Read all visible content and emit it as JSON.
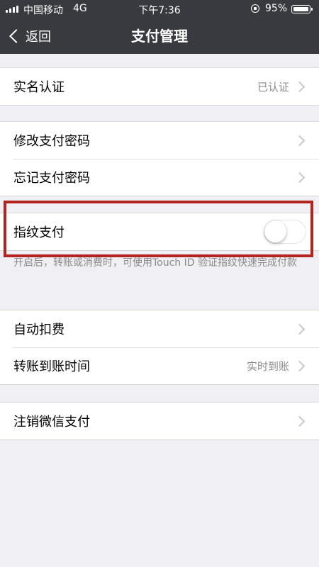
{
  "status_bar": {
    "carrier": "中国移动",
    "network": "4G",
    "time": "下午7:36",
    "battery_percent": "95%"
  },
  "nav": {
    "back_label": "返回",
    "title": "支付管理"
  },
  "groups": {
    "real_name": {
      "label": "实名认证",
      "value": "已认证"
    },
    "password": {
      "change_label": "修改支付密码",
      "forgot_label": "忘记支付密码"
    },
    "fingerprint": {
      "label": "指纹支付",
      "toggle_on": false,
      "hint": "开启后，转账或消费时，可使用Touch ID 验证指纹快速完成付款"
    },
    "payments": {
      "auto_deduct_label": "自动扣费",
      "transfer_time_label": "转账到账时间",
      "transfer_time_value": "实时到账"
    },
    "cancel": {
      "label": "注销微信支付"
    }
  },
  "colors": {
    "nav_background": "#393a3f",
    "page_background": "#efeff4",
    "highlight_border": "#b3231f",
    "secondary_text": "#8a8a8a"
  },
  "icons": [
    "signal-icon",
    "lock-rotation-icon",
    "battery-icon",
    "back-chevron-icon",
    "chevron-right-icon"
  ]
}
